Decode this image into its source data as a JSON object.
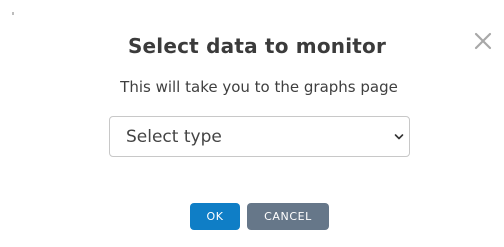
{
  "dialog": {
    "title": "Select data to monitor",
    "subtitle": "This will take you to the graphs page",
    "close_icon": "close-icon"
  },
  "type_select": {
    "selected": "Select type",
    "chevron_icon": "chevron-down-icon"
  },
  "actions": {
    "ok_label": "OK",
    "cancel_label": "CANCEL"
  },
  "colors": {
    "ok_button": "#0f7ec6",
    "cancel_button": "#667789",
    "title_text": "#3b3b3b",
    "close_icon": "#a8a8a8"
  }
}
